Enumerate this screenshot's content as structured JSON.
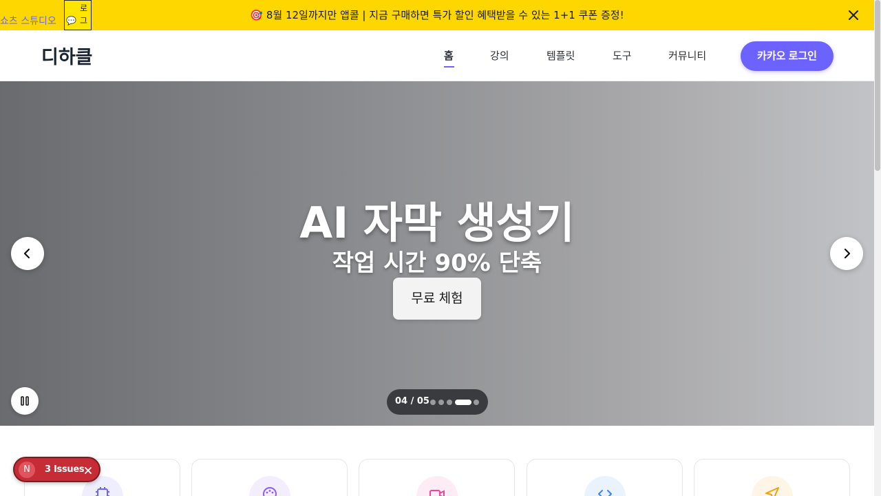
{
  "banner": {
    "text": "🎯 8월 12일까지만 앱콜 | 지금 구매하면 특가 할인 혜택받을 수 있는 1+1 쿠폰 증정!",
    "studio_link": "쇼츠 스튜디오",
    "kakao_mini_label": "로그"
  },
  "header": {
    "logo": "디하클",
    "nav": [
      "홈",
      "강의",
      "템플릿",
      "도구",
      "커뮤니티"
    ],
    "active_nav": "홈",
    "login_label": "카카오 로그인"
  },
  "hero": {
    "title": "AI 자막 생성기",
    "subtitle": "작업 시간 90% 단축",
    "cta": "무료 체험",
    "pager": "04 / 05",
    "current_slide": 4,
    "total_slides": 5
  },
  "cards": [
    {
      "icon": "chip-icon",
      "color": "#6c63ff",
      "bg": "#efeefe"
    },
    {
      "icon": "palette-icon",
      "color": "#8b5cf6",
      "bg": "#f3edfe"
    },
    {
      "icon": "video-icon",
      "color": "#ec4899",
      "bg": "#fdecf4"
    },
    {
      "icon": "code-icon",
      "color": "#3b82f6",
      "bg": "#eaf2fe"
    },
    {
      "icon": "send-icon",
      "color": "#f59e0b",
      "bg": "#fef5e6"
    }
  ],
  "issues": {
    "initial": "N",
    "label": "3 Issues"
  },
  "colors": {
    "accent": "#6c63ff",
    "banner": "#ffd700",
    "issues": "#c62c36"
  }
}
